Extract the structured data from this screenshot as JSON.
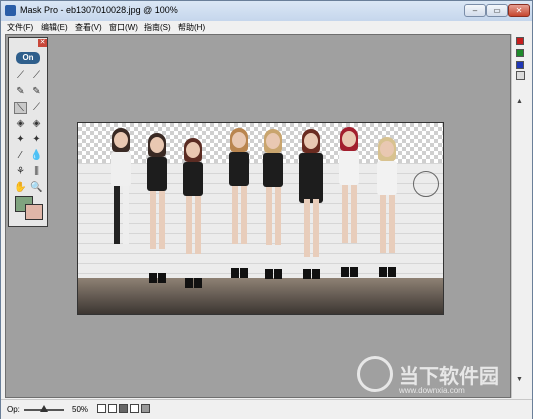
{
  "window": {
    "title": "Mask Pro - eb1307010028.jpg @ 100%",
    "controls": {
      "minimize": "–",
      "maximize": "▭",
      "close": "✕"
    }
  },
  "menubar": {
    "items": [
      "文件(F)",
      "编辑(E)",
      "查看(V)",
      "窗口(W)",
      "指南(S)",
      "帮助(H)"
    ]
  },
  "toolbox": {
    "logo": "On",
    "close": "✕",
    "tools": [
      "eyedropper-keep",
      "eyedropper-drop",
      "pen-keep",
      "pen-drop",
      "magic-brush-keep",
      "brush-drop",
      "fill-keep",
      "fill-drop",
      "magic-wand-keep",
      "magic-wand-drop",
      "chisel",
      "blur",
      "hose",
      "eraser",
      "hand",
      "zoom"
    ],
    "foreground_color": "#7fa37f",
    "background_color": "#e0b6a8"
  },
  "side_palette": {
    "colors": [
      "#c61e1e",
      "#1e8a2b",
      "#2037b5"
    ],
    "view_icon": "grid-view-icon"
  },
  "canvas": {
    "image_alt": "group photo on transparency grid"
  },
  "statusbar": {
    "op_label": "Op:",
    "op_value": "50%",
    "opacity": 0.5
  },
  "watermark": {
    "cn": "当下软件园",
    "url": "www.downxia.com"
  }
}
